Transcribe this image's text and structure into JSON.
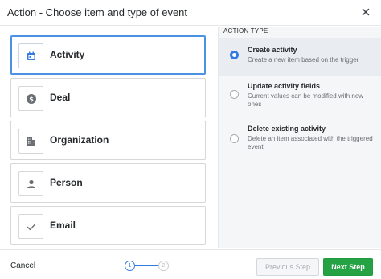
{
  "header": {
    "title": "Action - Choose item and type of event",
    "close_icon": "close-icon"
  },
  "items": [
    {
      "label": "Activity",
      "icon": "calendar-icon",
      "selected": true
    },
    {
      "label": "Deal",
      "icon": "dollar-icon",
      "selected": false
    },
    {
      "label": "Organization",
      "icon": "building-icon",
      "selected": false
    },
    {
      "label": "Person",
      "icon": "person-icon",
      "selected": false
    },
    {
      "label": "Email",
      "icon": "checkmark-icon",
      "selected": false
    }
  ],
  "action_type": {
    "section_label": "ACTION TYPE",
    "options": [
      {
        "title": "Create activity",
        "description": "Create a new item based on the trigger",
        "selected": true
      },
      {
        "title": "Update activity fields",
        "description": "Current values can be modified with new ones",
        "selected": false
      },
      {
        "title": "Delete existing activity",
        "description": "Delete an item associated with the triggered event",
        "selected": false
      }
    ]
  },
  "footer": {
    "cancel_label": "Cancel",
    "steps": [
      "1",
      "2"
    ],
    "current_step": 1,
    "previous_label": "Previous Step",
    "next_label": "Next Step"
  },
  "colors": {
    "accent": "#317ae2",
    "next_button": "#25a244",
    "panel_bg": "#f5f6f7"
  }
}
